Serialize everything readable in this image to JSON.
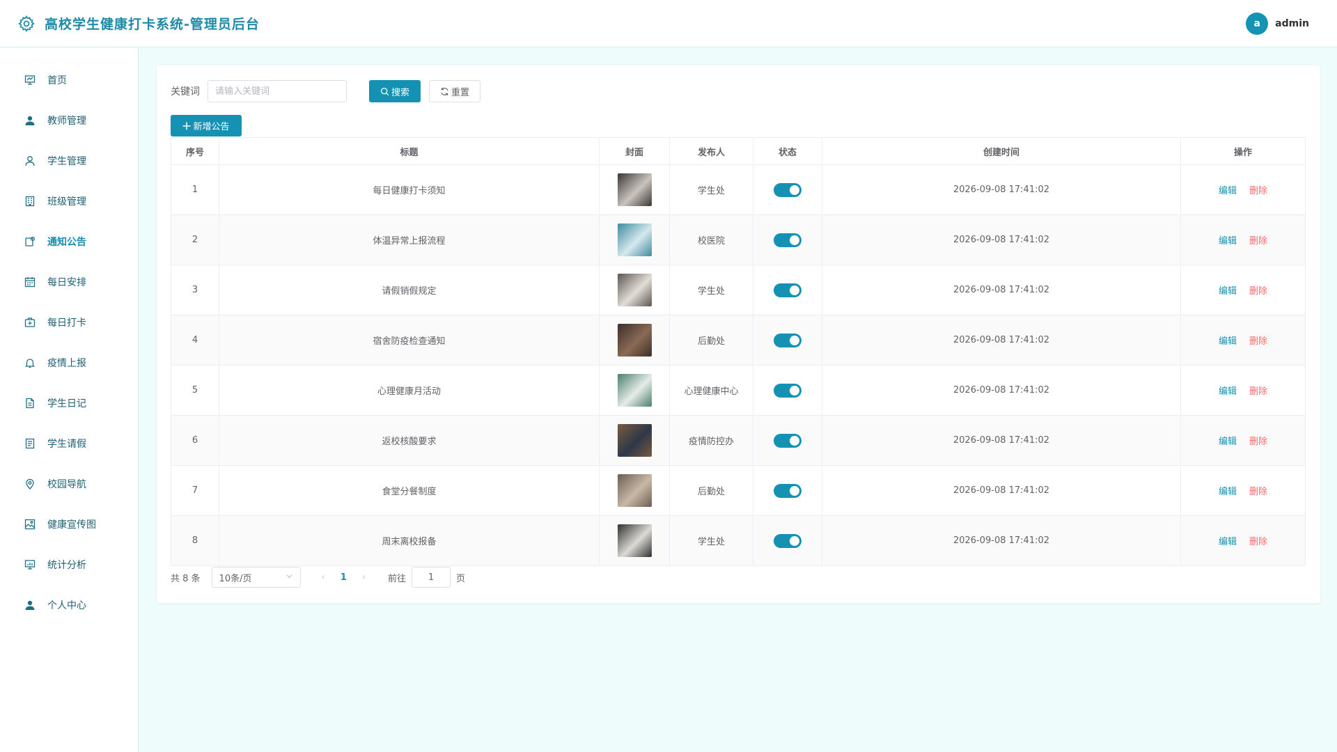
{
  "header": {
    "title": "高校学生健康打卡系统-管理员后台",
    "logo_icon": "gear-icon",
    "avatar_letter": "a",
    "username": "admin"
  },
  "colors": {
    "primary": "#1591b3",
    "danger": "#f56c6c",
    "background": "#eefcfc"
  },
  "sidebar": {
    "items": [
      {
        "label": "首页",
        "icon": "presentation-icon"
      },
      {
        "label": "教师管理",
        "icon": "user-filled-icon"
      },
      {
        "label": "学生管理",
        "icon": "user-outline-icon"
      },
      {
        "label": "班级管理",
        "icon": "building-icon"
      },
      {
        "label": "通知公告",
        "icon": "notice-icon",
        "active": true
      },
      {
        "label": "每日安排",
        "icon": "calendar-icon"
      },
      {
        "label": "每日打卡",
        "icon": "first-aid-icon"
      },
      {
        "label": "疫情上报",
        "icon": "bell-icon"
      },
      {
        "label": "学生日记",
        "icon": "document-icon"
      },
      {
        "label": "学生请假",
        "icon": "tickets-icon"
      },
      {
        "label": "校园导航",
        "icon": "location-icon"
      },
      {
        "label": "健康宣传图",
        "icon": "picture-icon"
      },
      {
        "label": "统计分析",
        "icon": "chart-board-icon"
      },
      {
        "label": "个人中心",
        "icon": "user-filled-icon"
      }
    ]
  },
  "search": {
    "label": "关键词",
    "placeholder": "请输入关键词",
    "value": "",
    "search_label": "搜索",
    "reset_label": "重置",
    "add_label": "新增公告"
  },
  "table": {
    "columns": [
      "序号",
      "标题",
      "封面",
      "发布人",
      "状态",
      "创建时间",
      "操作"
    ],
    "edit_label": "编辑",
    "delete_label": "删除",
    "rows": [
      {
        "no": "1",
        "title": "每日健康打卡须知",
        "publisher": "学生处",
        "status": true,
        "created": "2026-09-08 17:41:02",
        "cover": [
          "#3b3632",
          "#c9c4bd"
        ]
      },
      {
        "no": "2",
        "title": "体温异常上报流程",
        "publisher": "校医院",
        "status": true,
        "created": "2026-09-08 17:41:02",
        "cover": [
          "#3e8aa0",
          "#d5e8ee"
        ]
      },
      {
        "no": "3",
        "title": "请假销假规定",
        "publisher": "学生处",
        "status": true,
        "created": "2026-09-08 17:41:02",
        "cover": [
          "#5a5550",
          "#e2ddd6"
        ]
      },
      {
        "no": "4",
        "title": "宿舍防疫检查通知",
        "publisher": "后勤处",
        "status": true,
        "created": "2026-09-08 17:41:02",
        "cover": [
          "#3c2f28",
          "#8a6a55"
        ]
      },
      {
        "no": "5",
        "title": "心理健康月活动",
        "publisher": "心理健康中心",
        "status": true,
        "created": "2026-09-08 17:41:02",
        "cover": [
          "#4a7f6e",
          "#e6ece7"
        ]
      },
      {
        "no": "6",
        "title": "返校核酸要求",
        "publisher": "疫情防控办",
        "status": true,
        "created": "2026-09-08 17:41:02",
        "cover": [
          "#7a5a40",
          "#2d3848"
        ]
      },
      {
        "no": "7",
        "title": "食堂分餐制度",
        "publisher": "后勤处",
        "status": true,
        "created": "2026-09-08 17:41:02",
        "cover": [
          "#6b5e52",
          "#c8b9a5"
        ]
      },
      {
        "no": "8",
        "title": "周末离校报备",
        "publisher": "学生处",
        "status": true,
        "created": "2026-09-08 17:41:02",
        "cover": [
          "#2f3030",
          "#dcdad5"
        ]
      }
    ]
  },
  "pagination": {
    "total_text": "共 8 条",
    "page_size": "10条/页",
    "current_page": "1",
    "goto_label": "前往",
    "goto_value": "1",
    "page_suffix": "页"
  }
}
